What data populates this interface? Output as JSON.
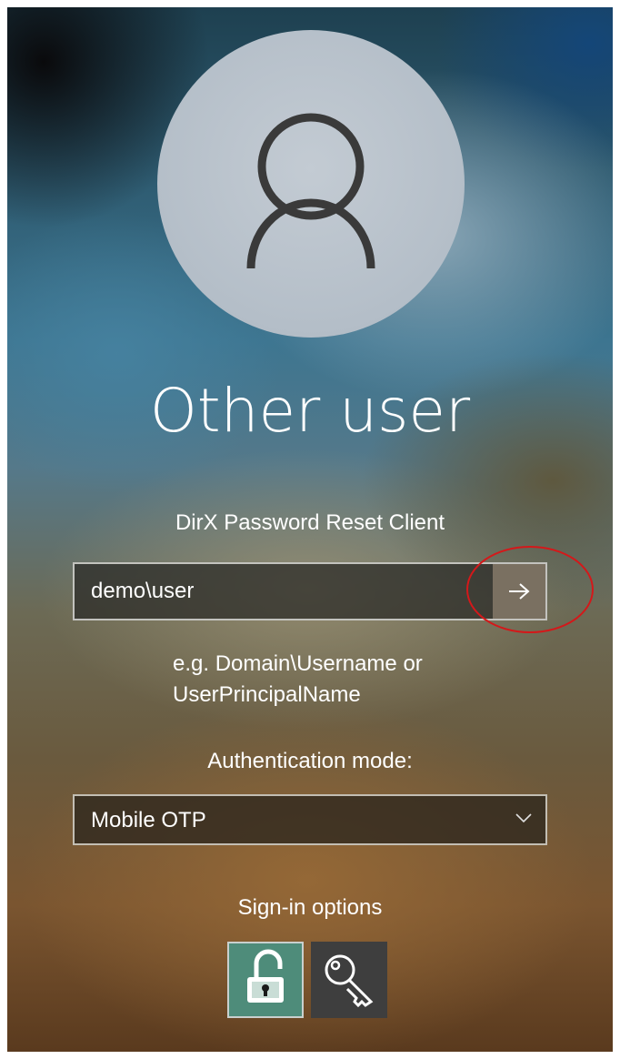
{
  "user": {
    "name": "Other user",
    "client_name": "DirX Password Reset Client"
  },
  "username_field": {
    "value": "demo\\user",
    "submit_icon": "arrow-right-icon"
  },
  "hint_lines": [
    "e.g. Domain\\Username or",
    "UserPrincipalName"
  ],
  "authentication": {
    "label": "Authentication mode:",
    "selected": "Mobile OTP"
  },
  "signin_options": {
    "label": "Sign-in options",
    "options": [
      {
        "icon": "unlock-icon",
        "selected": true
      },
      {
        "icon": "key-icon",
        "selected": false
      }
    ]
  },
  "colors": {
    "highlight": "#d4181a",
    "selected_option": "#4e8c7a",
    "option": "#3e3e3e"
  }
}
